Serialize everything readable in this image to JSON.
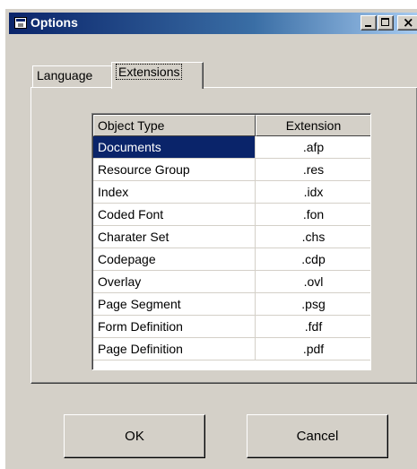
{
  "window": {
    "title": "Options",
    "title_icon": "app-window-icon",
    "controls": {
      "minimize": "minimize-icon",
      "maximize": "maximize-icon",
      "close": "close-icon",
      "close_glyph": "×"
    }
  },
  "tabs": [
    {
      "label": "Language",
      "selected": false
    },
    {
      "label": "Extensions",
      "selected": true
    }
  ],
  "table": {
    "columns": [
      "Object Type",
      "Extension"
    ],
    "rows": [
      {
        "name": "Documents",
        "ext": ".afp",
        "selected": true
      },
      {
        "name": "Resource Group",
        "ext": ".res"
      },
      {
        "name": "Index",
        "ext": ".idx"
      },
      {
        "name": "Coded Font",
        "ext": ".fon"
      },
      {
        "name": "Charater Set",
        "ext": ".chs"
      },
      {
        "name": "Codepage",
        "ext": ".cdp"
      },
      {
        "name": "Overlay",
        "ext": ".ovl"
      },
      {
        "name": "Page Segment",
        "ext": ".psg"
      },
      {
        "name": "Form Definition",
        "ext": ".fdf"
      },
      {
        "name": "Page Definition",
        "ext": ".pdf"
      }
    ]
  },
  "buttons": {
    "ok": "OK",
    "cancel": "Cancel"
  },
  "colors": {
    "face": "#d4d0c8",
    "titlebar_start": "#0a246a",
    "titlebar_end": "#a6caf0",
    "selection": "#0a246a"
  }
}
